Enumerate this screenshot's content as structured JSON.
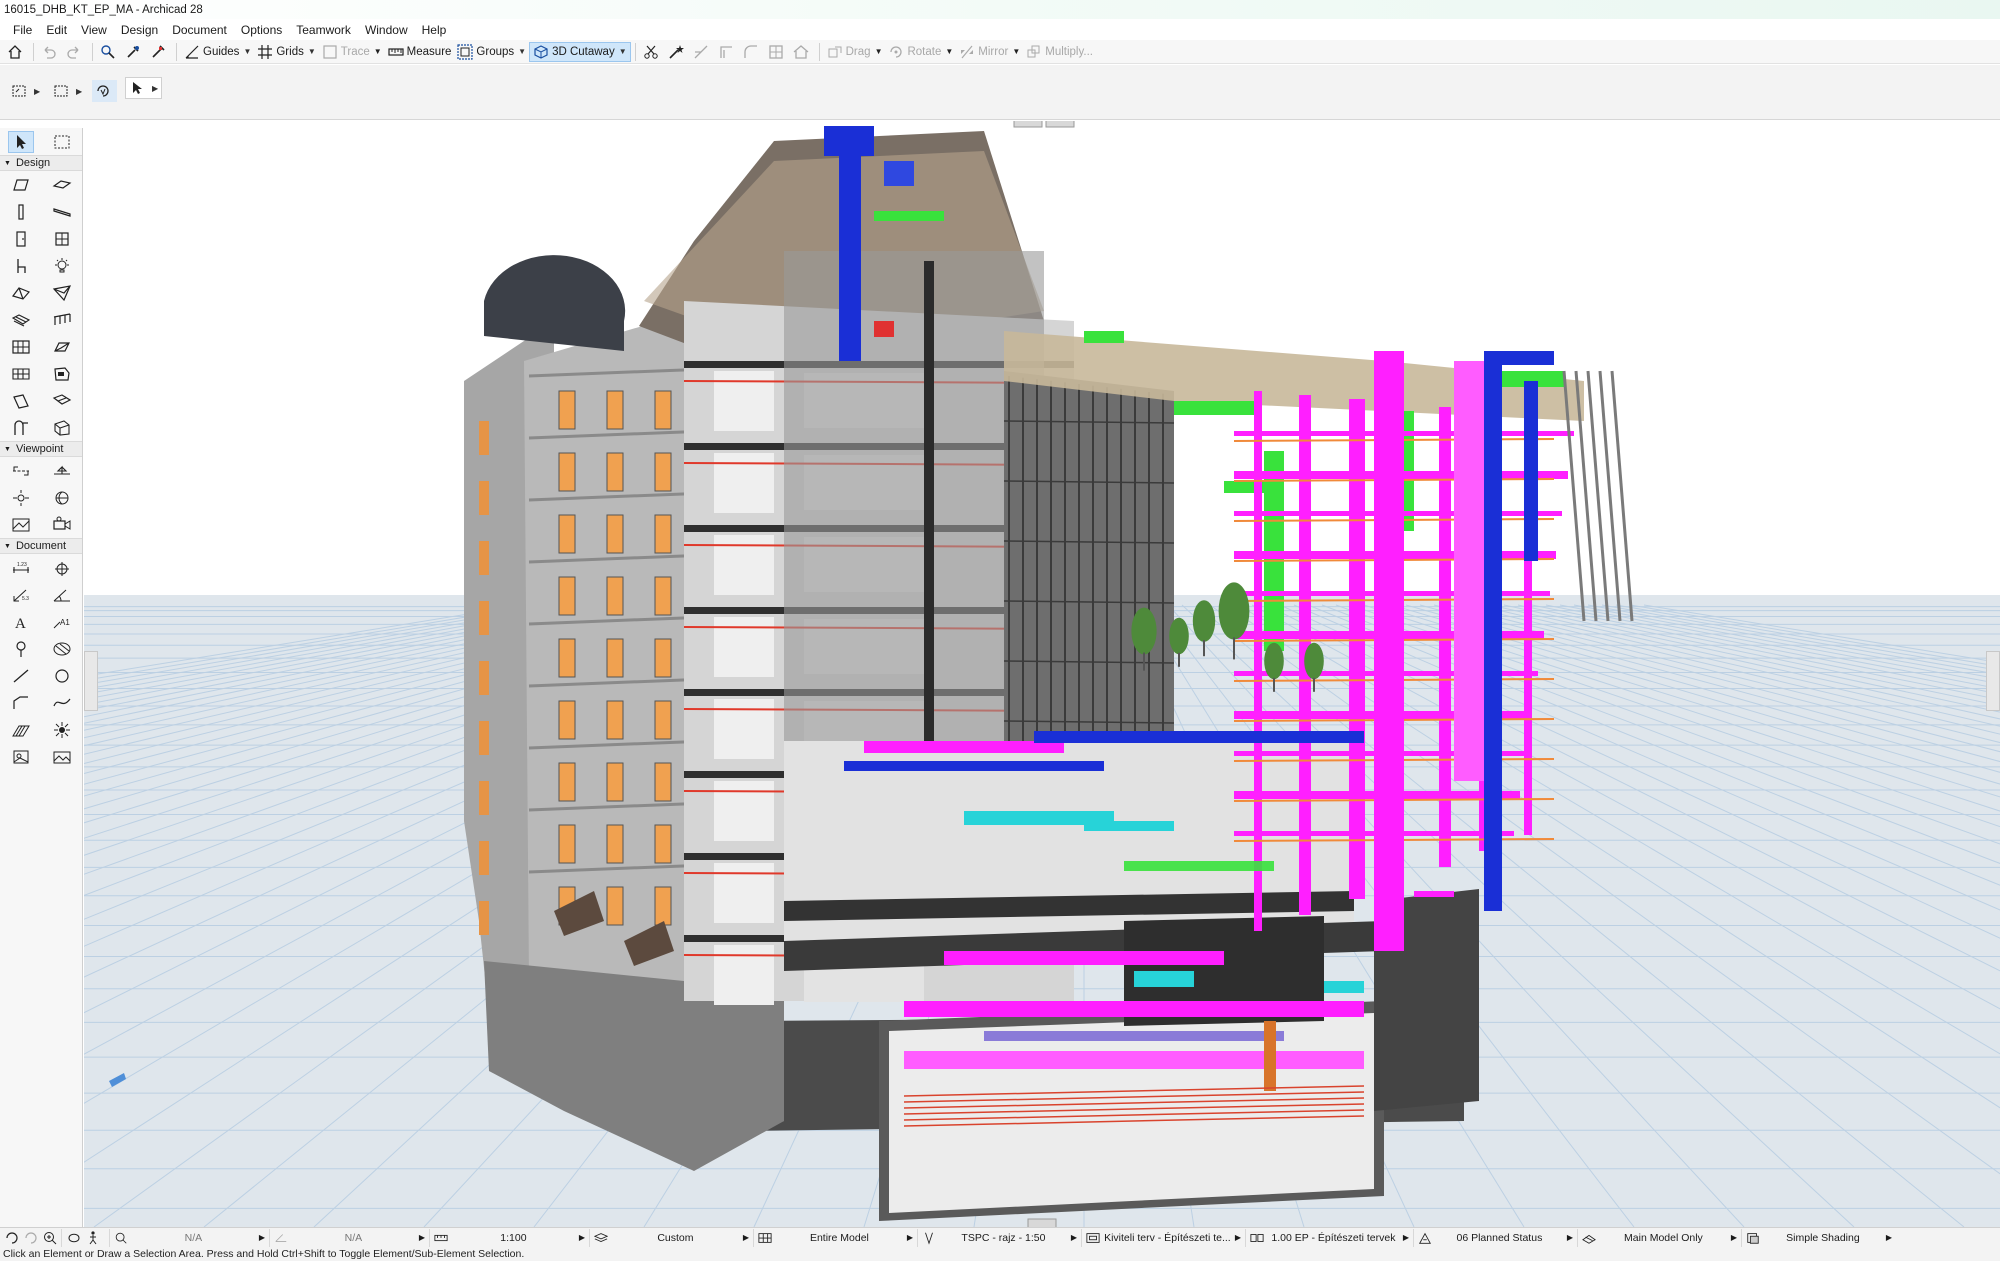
{
  "window": {
    "title": "16015_DHB_KT_EP_MA - Archicad 28"
  },
  "menu": [
    "File",
    "Edit",
    "View",
    "Design",
    "Document",
    "Options",
    "Teamwork",
    "Window",
    "Help"
  ],
  "toolbar": {
    "guides": "Guides",
    "grids": "Grids",
    "trace": "Trace",
    "measure": "Measure",
    "groups": "Groups",
    "cutaway": "3D Cutaway",
    "drag": "Drag",
    "rotate": "Rotate",
    "mirror": "Mirror",
    "multiply": "Multiply..."
  },
  "toolbox": {
    "sections": [
      "Design",
      "Viewpoint",
      "Document"
    ]
  },
  "statusbar": {
    "zoom_value": "N/A",
    "angle_value": "N/A",
    "scale": "1:100",
    "layer_combo": "Custom",
    "model_view": "Entire Model",
    "pen_set": "TSPC - rajz - 1:50",
    "graphic_override": "Kiviteli terv - Építészeti te...",
    "dimension": "1.00 EP - Építészeti tervek",
    "renovation": "06 Planned Status",
    "structural": "Main Model Only",
    "shading": "Simple Shading"
  },
  "hint": "Click an Element or Draw a Selection Area. Press and Hold Ctrl+Shift to Toggle Element/Sub-Element Selection.",
  "colors": {
    "accent": "#cfe6fa",
    "magenta_pipes": "#ff1fff",
    "blue_ducts": "#1a2fd6",
    "green_ducts": "#39e23c",
    "cyan_ducts": "#27d3d8",
    "grid_floor": "#d2e1f0"
  }
}
